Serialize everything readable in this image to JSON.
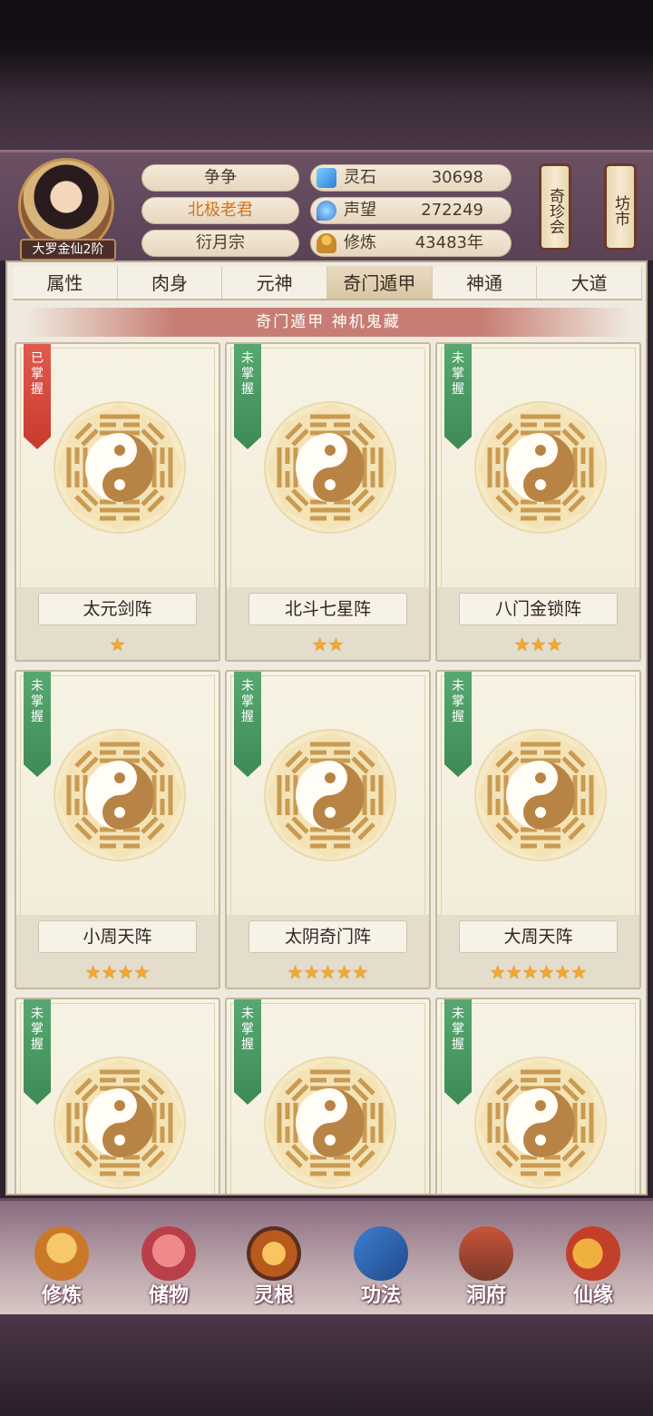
{
  "header": {
    "player_name": "争争",
    "title": "北极老君",
    "sect": "衍月宗",
    "realm": "大罗金仙2阶",
    "resources": [
      {
        "icon": "spirit-stone-icon",
        "name": "灵石",
        "value": "30698"
      },
      {
        "icon": "reputation-icon",
        "name": "声望",
        "value": "272249"
      },
      {
        "icon": "cultivation-icon",
        "name": "修炼",
        "value": "43483年"
      }
    ],
    "side_buttons": [
      "奇珍会",
      "坊市"
    ]
  },
  "tabs": [
    "属性",
    "肉身",
    "元神",
    "奇门遁甲",
    "神通",
    "大道"
  ],
  "active_tab": "奇门遁甲",
  "subtitle": "奇门遁甲  神机鬼藏",
  "formations": [
    {
      "status": "已掌握",
      "name": "太元剑阵",
      "stars": "★",
      "star_count": 1
    },
    {
      "status": "未掌握",
      "name": "北斗七星阵",
      "stars": "★★",
      "star_count": 2
    },
    {
      "status": "未掌握",
      "name": "八门金锁阵",
      "stars": "★★★",
      "star_count": 3
    },
    {
      "status": "未掌握",
      "name": "小周天阵",
      "stars": "★★★★",
      "star_count": 4
    },
    {
      "status": "未掌握",
      "name": "太阴奇门阵",
      "stars": "★★★★★",
      "star_count": 5
    },
    {
      "status": "未掌握",
      "name": "大周天阵",
      "stars": "★★★★★★",
      "star_count": 6
    },
    {
      "status": "未掌握",
      "name": "",
      "stars": "",
      "star_count": 0
    },
    {
      "status": "未掌握",
      "name": "",
      "stars": "",
      "star_count": 0
    },
    {
      "status": "未掌握",
      "name": "",
      "stars": "",
      "star_count": 0
    }
  ],
  "bottom_nav": [
    {
      "label": "修炼",
      "icon": "meditation-icon"
    },
    {
      "label": "储物",
      "icon": "storage-bag-icon"
    },
    {
      "label": "灵根",
      "icon": "spirit-root-icon"
    },
    {
      "label": "功法",
      "icon": "technique-book-icon"
    },
    {
      "label": "洞府",
      "icon": "cave-dwelling-icon"
    },
    {
      "label": "仙缘",
      "icon": "gourd-icon"
    }
  ],
  "colors": {
    "mastered_ribbon": "#c9392e",
    "unmastered_ribbon": "#3e8a57",
    "star": "#f3a72b",
    "title_highlight": "#d4731c",
    "subtitle_bar": "#c77d73"
  }
}
